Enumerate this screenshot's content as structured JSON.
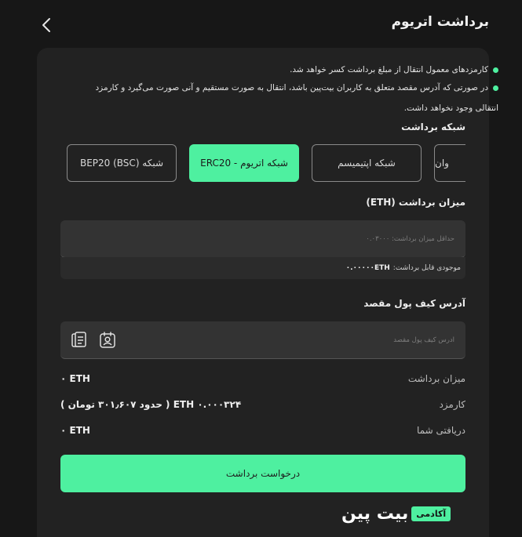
{
  "header": {
    "title": "برداشت اتریوم",
    "back_icon": "chevron-left-icon"
  },
  "notes": [
    "کارمزدهای معمول انتقال از مبلغ برداشت کسر خواهد شد.",
    "در صورتی که آدرس مقصد متعلق به کاربران بیت‌پین باشد، انتقال به صورت مستقیم و آنی صورت می‌گیرد و کارمزد انتقالی وجود نخواهد داشت."
  ],
  "network": {
    "label": "شبکه برداشت",
    "options": [
      {
        "label": "شبکه (BEP20 (BSC",
        "active": false
      },
      {
        "label": "شبکه اتریوم - ERC20",
        "active": true
      },
      {
        "label": "شبکه اپتیمیسم",
        "active": false
      },
      {
        "label": "وان",
        "active": false
      }
    ]
  },
  "amount": {
    "label": "میزان برداشت (ETH)",
    "placeholder": "حداقل میزان برداشت: ۰.۰۳۰۰۰",
    "value": "",
    "balance_label": "موجودی قابل برداشت:",
    "balance_value": "۰.۰۰۰۰۰ETH"
  },
  "address": {
    "label": "آدرس کیف پول مقصد",
    "placeholder": "آدرس کیف پول مقصد",
    "value": "",
    "icons": [
      "paste-clipboard-icon",
      "contact-book-icon"
    ]
  },
  "summary": [
    {
      "label": "میزان برداشت",
      "value": "۰ ETH"
    },
    {
      "label": "کارمزد",
      "value": "۰.۰۰۰۳۲۴ ETH ( حدود ۳۰۱٫۶۰۷ تومان )"
    },
    {
      "label": "دریافتی شما",
      "value": "۰ ETH"
    }
  ],
  "submit_label": "درخواست برداشت",
  "brand": {
    "name": "بیت پین",
    "tag": "آکادمی"
  },
  "colors": {
    "accent": "#4ef0a0",
    "background": "#171717",
    "card": "#222222",
    "field": "#333333"
  }
}
